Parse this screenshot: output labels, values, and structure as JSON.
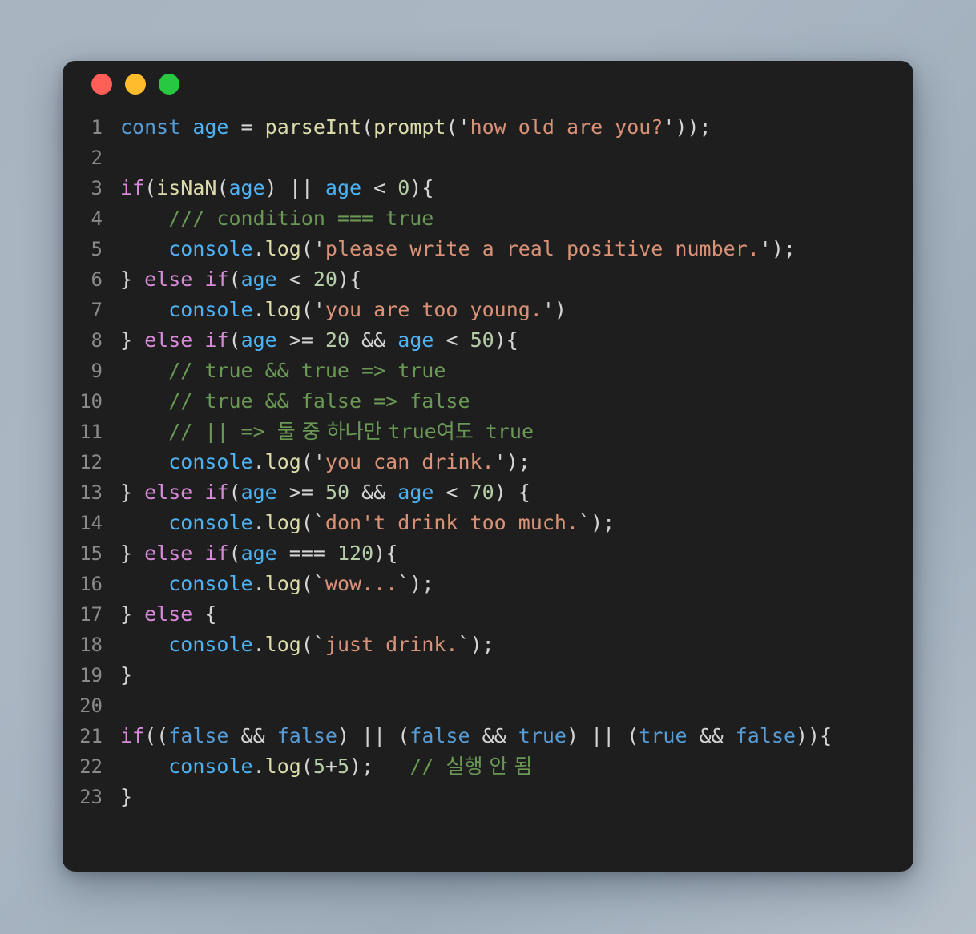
{
  "window": {
    "name": "code-snippet-window",
    "background_color": "#1e1e1e",
    "page_background": "#a8b4c0",
    "traffic_lights": [
      {
        "name": "close",
        "color": "#ff5f57"
      },
      {
        "name": "minimize",
        "color": "#ffbd2e"
      },
      {
        "name": "maximize",
        "color": "#28c840"
      }
    ]
  },
  "editor": {
    "language": "javascript",
    "theme": "dark",
    "line_number_color": "#8a8a8a",
    "token_colors": {
      "keyword": "#569cd6",
      "control": "#d98ad9",
      "function": "#dcdcaa",
      "variable": "#4eb3f5",
      "string": "#d99277",
      "number": "#b5cea8",
      "comment": "#6a9955",
      "punctuation": "#d4d4d4"
    },
    "line_numbers": [
      "1",
      "2",
      "3",
      "4",
      "5",
      "6",
      "7",
      "8",
      "9",
      "10",
      "11",
      "12",
      "13",
      "14",
      "15",
      "16",
      "17",
      "18",
      "19",
      "20",
      "21",
      "22",
      "23"
    ],
    "lines": [
      "const age = parseInt(prompt('how old are you?'));",
      "",
      "if(isNaN(age) || age < 0){",
      "    /// condition === true",
      "    console.log('please write a real positive number.');",
      "} else if(age < 20){",
      "    console.log('you are too young.')",
      "} else if(age >= 20 && age < 50){",
      "    // true && true => true",
      "    // true && false => false",
      "    // || => 둘 중 하나만 true여도 true",
      "    console.log('you can drink.');",
      "} else if(age >= 50 && age < 70) {",
      "    console.log(`don't drink too much.`);",
      "} else if(age === 120){",
      "    console.log(`wow...`);",
      "} else {",
      "    console.log(`just drink.`);",
      "}",
      "",
      "if((false && false) || (false && true) || (true && false)){",
      "    console.log(5+5);   // 실행 안 됨",
      "}"
    ]
  }
}
